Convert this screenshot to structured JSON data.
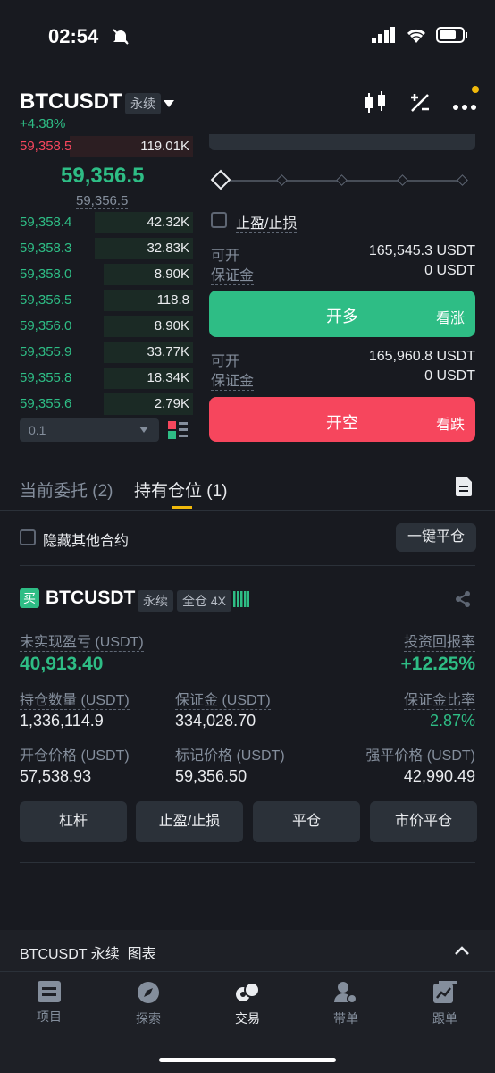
{
  "status": {
    "time": "02:54"
  },
  "header": {
    "symbol": "BTCUSDT",
    "contract_type": "永续",
    "change": "+4.38%"
  },
  "orderbook": {
    "asks": [
      {
        "price": "59,358.5",
        "qty": "119.01K"
      }
    ],
    "last_price": "59,356.5",
    "mark_price": "59,356.5",
    "bids": [
      {
        "price": "59,358.4",
        "qty": "42.32K"
      },
      {
        "price": "59,358.3",
        "qty": "32.83K"
      },
      {
        "price": "59,358.0",
        "qty": "8.90K"
      },
      {
        "price": "59,356.5",
        "qty": "118.8"
      },
      {
        "price": "59,356.0",
        "qty": "8.90K"
      },
      {
        "price": "59,355.9",
        "qty": "33.77K"
      },
      {
        "price": "59,355.8",
        "qty": "18.34K"
      },
      {
        "price": "59,355.6",
        "qty": "2.79K"
      }
    ],
    "precision": "0.1"
  },
  "order_form": {
    "tp_sl_label": "止盈/止损",
    "long": {
      "avail_label": "可开",
      "avail_value": "165,545.3 USDT",
      "margin_label": "保证金",
      "margin_value": "0 USDT",
      "button": "开多",
      "button_sub": "看涨"
    },
    "short": {
      "avail_label": "可开",
      "avail_value": "165,960.8 USDT",
      "margin_label": "保证金",
      "margin_value": "0 USDT",
      "button": "开空",
      "button_sub": "看跌"
    }
  },
  "tabs": {
    "open_orders": "当前委托 (2)",
    "positions": "持有仓位 (1)"
  },
  "filter": {
    "hide_other": "隐藏其他合约",
    "close_all": "一键平仓"
  },
  "position": {
    "side_tag": "买",
    "symbol": "BTCUSDT",
    "contract_type": "永续",
    "margin_mode": "全仓 4X",
    "upnl_label": "未实现盈亏 (USDT)",
    "upnl_value": "40,913.40",
    "roi_label": "投资回报率",
    "roi_value": "+12.25%",
    "size_label": "持仓数量 (USDT)",
    "size_value": "1,336,114.9",
    "margin_label": "保证金 (USDT)",
    "margin_value": "334,028.70",
    "margin_ratio_label": "保证金比率",
    "margin_ratio_value": "2.87%",
    "entry_label": "开仓价格 (USDT)",
    "entry_value": "57,538.93",
    "mark_label": "标记价格 (USDT)",
    "mark_value": "59,356.50",
    "liq_label": "强平价格 (USDT)",
    "liq_value": "42,990.49",
    "actions": [
      "杠杆",
      "止盈/止损",
      "平仓",
      "市价平仓"
    ]
  },
  "chart_bar": {
    "label": "BTCUSDT 永续  图表"
  },
  "nav": [
    {
      "label": "项目",
      "icon": "list-icon"
    },
    {
      "label": "探索",
      "icon": "compass-icon"
    },
    {
      "label": "交易",
      "icon": "trade-icon"
    },
    {
      "label": "带单",
      "icon": "copy-trader-icon"
    },
    {
      "label": "跟单",
      "icon": "follow-chart-icon"
    }
  ],
  "colors": {
    "green": "#2ebd85",
    "red": "#f6465d",
    "accent": "#f0b90b",
    "background": "#181a20"
  }
}
